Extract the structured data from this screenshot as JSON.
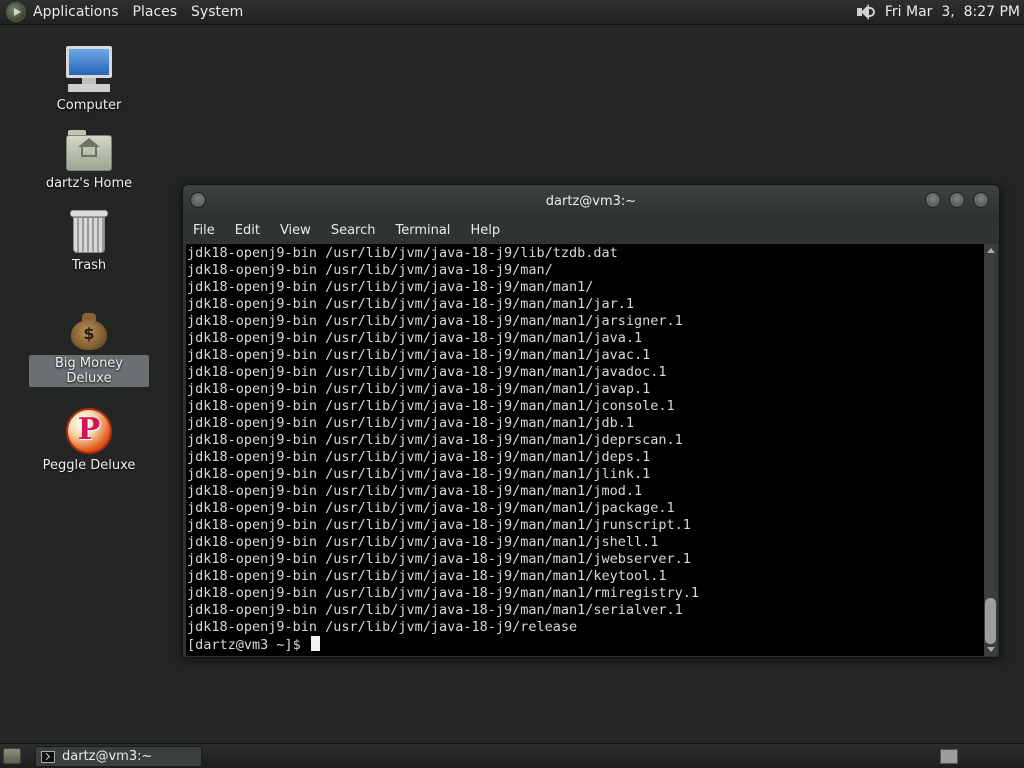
{
  "top_panel": {
    "menus": [
      "Applications",
      "Places",
      "System"
    ],
    "clock": "Fri Mar  3,  8:27 PM"
  },
  "desktop_icons": [
    {
      "label": "Computer",
      "icon": "computer-icon"
    },
    {
      "label": "dartz's Home",
      "icon": "home-folder-icon"
    },
    {
      "label": "Trash",
      "icon": "trash-icon"
    },
    {
      "label": "Big Money Deluxe",
      "icon": "money-bag-icon",
      "selected": true
    },
    {
      "label": "Peggle Deluxe",
      "icon": "peggle-icon"
    }
  ],
  "terminal": {
    "title": "dartz@vm3:~",
    "menu": [
      "File",
      "Edit",
      "View",
      "Search",
      "Terminal",
      "Help"
    ],
    "lines": [
      "jdk18-openj9-bin /usr/lib/jvm/java-18-j9/lib/tzdb.dat",
      "jdk18-openj9-bin /usr/lib/jvm/java-18-j9/man/",
      "jdk18-openj9-bin /usr/lib/jvm/java-18-j9/man/man1/",
      "jdk18-openj9-bin /usr/lib/jvm/java-18-j9/man/man1/jar.1",
      "jdk18-openj9-bin /usr/lib/jvm/java-18-j9/man/man1/jarsigner.1",
      "jdk18-openj9-bin /usr/lib/jvm/java-18-j9/man/man1/java.1",
      "jdk18-openj9-bin /usr/lib/jvm/java-18-j9/man/man1/javac.1",
      "jdk18-openj9-bin /usr/lib/jvm/java-18-j9/man/man1/javadoc.1",
      "jdk18-openj9-bin /usr/lib/jvm/java-18-j9/man/man1/javap.1",
      "jdk18-openj9-bin /usr/lib/jvm/java-18-j9/man/man1/jconsole.1",
      "jdk18-openj9-bin /usr/lib/jvm/java-18-j9/man/man1/jdb.1",
      "jdk18-openj9-bin /usr/lib/jvm/java-18-j9/man/man1/jdeprscan.1",
      "jdk18-openj9-bin /usr/lib/jvm/java-18-j9/man/man1/jdeps.1",
      "jdk18-openj9-bin /usr/lib/jvm/java-18-j9/man/man1/jlink.1",
      "jdk18-openj9-bin /usr/lib/jvm/java-18-j9/man/man1/jmod.1",
      "jdk18-openj9-bin /usr/lib/jvm/java-18-j9/man/man1/jpackage.1",
      "jdk18-openj9-bin /usr/lib/jvm/java-18-j9/man/man1/jrunscript.1",
      "jdk18-openj9-bin /usr/lib/jvm/java-18-j9/man/man1/jshell.1",
      "jdk18-openj9-bin /usr/lib/jvm/java-18-j9/man/man1/jwebserver.1",
      "jdk18-openj9-bin /usr/lib/jvm/java-18-j9/man/man1/keytool.1",
      "jdk18-openj9-bin /usr/lib/jvm/java-18-j9/man/man1/rmiregistry.1",
      "jdk18-openj9-bin /usr/lib/jvm/java-18-j9/man/man1/serialver.1",
      "jdk18-openj9-bin /usr/lib/jvm/java-18-j9/release"
    ],
    "prompt": "[dartz@vm3 ~]$ "
  },
  "bottom_panel": {
    "tasks": [
      {
        "label": "dartz@vm3:~",
        "icon": "terminal-icon"
      }
    ]
  }
}
